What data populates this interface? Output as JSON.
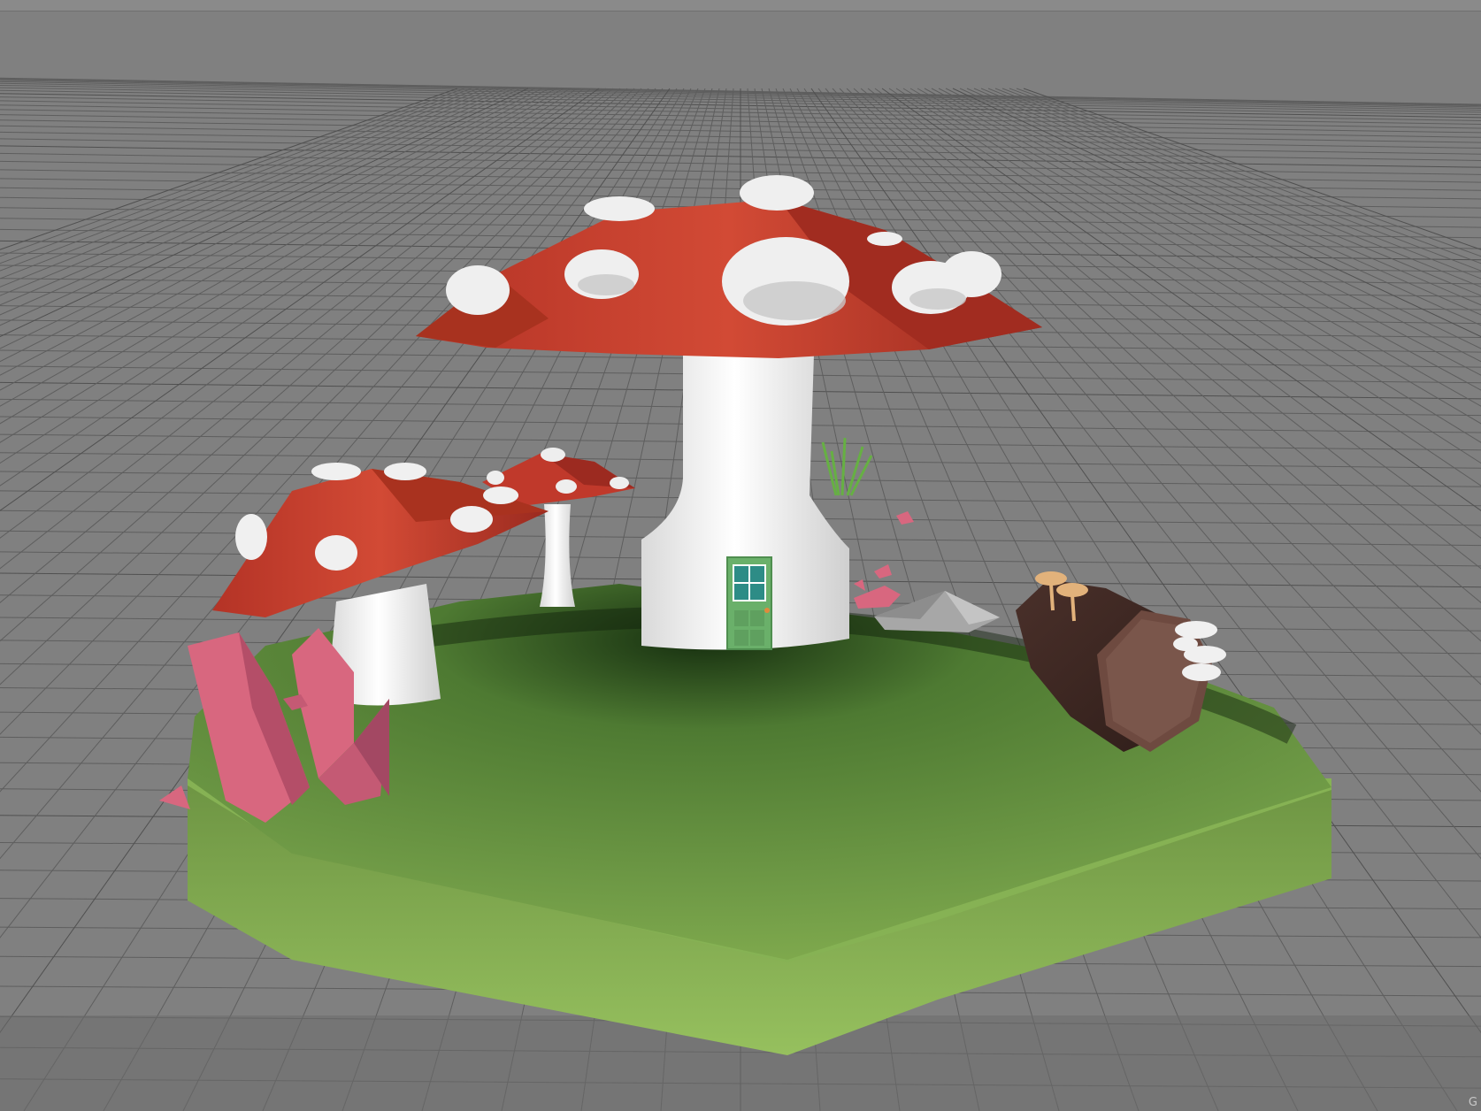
{
  "viewport": {
    "kind": "3d-perspective-viewport",
    "background_color": "#808080",
    "grid_color": "#5d5d5d",
    "corner_label": "G"
  },
  "scene": {
    "objects": [
      {
        "name": "grass-base",
        "color": "#7fa44f"
      },
      {
        "name": "mushroom-house",
        "cap_color": "#c03a2b",
        "stem_color": "#f2f2f2",
        "spot_color": "#ececec"
      },
      {
        "name": "door",
        "color": "#6ab06a",
        "window_color": "#2d8c86"
      },
      {
        "name": "small-mushroom",
        "cap_color": "#c8412f"
      },
      {
        "name": "tiny-mushroom",
        "cap_color": "#c0392b"
      },
      {
        "name": "pink-crystals",
        "color": "#d8677f"
      },
      {
        "name": "log",
        "color": "#5a3e36"
      },
      {
        "name": "rock",
        "color": "#a6a6a6"
      },
      {
        "name": "grass-tuft",
        "color": "#6bb548"
      }
    ]
  }
}
